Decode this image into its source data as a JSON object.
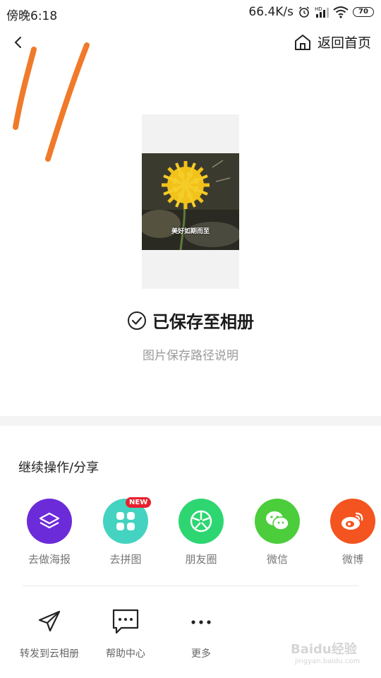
{
  "status_bar": {
    "time": "傍晚6:18",
    "speed": "66.4K/s",
    "battery": "70",
    "icons": [
      "alarm-icon",
      "signal-icon",
      "wifi-icon",
      "battery-icon"
    ]
  },
  "nav": {
    "back_icon": "chevron-left-icon",
    "home_label": "返回首页",
    "home_icon": "home-icon"
  },
  "preview": {
    "caption": "美好如期而至"
  },
  "result": {
    "title": "已保存至相册",
    "subtitle": "图片保存路径说明",
    "icon": "check-circle-icon"
  },
  "share_section": {
    "title": "继续操作/分享",
    "items": [
      {
        "label": "去做海报",
        "icon": "layers-icon",
        "color": "#6c2bd9"
      },
      {
        "label": "去拼图",
        "icon": "grid-icon",
        "color": "#44d3c0",
        "badge": "NEW"
      },
      {
        "label": "朋友圈",
        "icon": "moments-icon",
        "color": "#2ed672"
      },
      {
        "label": "微信",
        "icon": "wechat-icon",
        "color": "#4ccd3c"
      },
      {
        "label": "微博",
        "icon": "weibo-icon",
        "color": "#f4541f"
      }
    ]
  },
  "tools": [
    {
      "label": "转发到云相册",
      "icon": "send-icon"
    },
    {
      "label": "帮助中心",
      "icon": "message-icon"
    },
    {
      "label": "更多",
      "icon": "more-icon"
    }
  ],
  "watermark": {
    "text": "Baidu经验",
    "url": "jingyan.baidu.com"
  }
}
